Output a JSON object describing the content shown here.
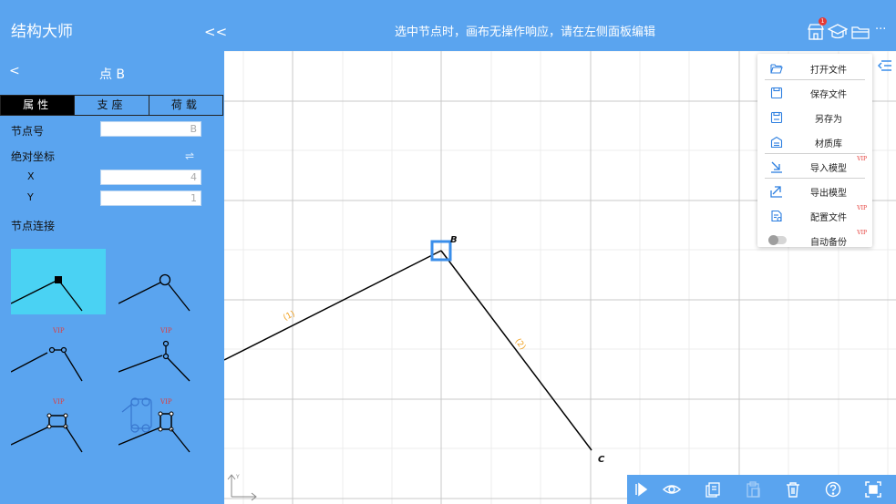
{
  "app": {
    "title": "结构大师",
    "collapse_label": "<<",
    "hint": "选中节点时，画布无操作响应，请在左侧面板编辑",
    "notification_count": "1",
    "more_label": "···"
  },
  "panel": {
    "back_label": "<",
    "title": "点 B",
    "tabs": [
      {
        "label": "属性",
        "active": true
      },
      {
        "label": "支座",
        "active": false
      },
      {
        "label": "荷载",
        "active": false
      }
    ],
    "node_id_label": "节点号",
    "node_id_value": "B",
    "abs_coord_label": "绝对坐标",
    "x_label": "X",
    "x_value": "4",
    "y_label": "Y",
    "y_value": "1",
    "connection_label": "节点连接",
    "connection_types": [
      {
        "icon": "rigid-joint-icon",
        "selected": true,
        "vip": ""
      },
      {
        "icon": "hinge-joint-icon",
        "selected": false,
        "vip": ""
      },
      {
        "icon": "link-joint-icon",
        "selected": false,
        "vip": "VIP"
      },
      {
        "icon": "slider-joint-icon",
        "selected": false,
        "vip": "VIP"
      },
      {
        "icon": "box-link-joint-icon",
        "selected": false,
        "vip": "VIP"
      },
      {
        "icon": "box-slider-joint-icon",
        "selected": false,
        "vip": "VIP"
      }
    ]
  },
  "canvas": {
    "node_b_label": "B",
    "node_c_label": "C",
    "element_1_label": "(1)",
    "element_2_label": "(2)",
    "axis_y_label": "Y"
  },
  "menu": {
    "items": [
      {
        "label": "打开文件",
        "icon": "folder-open-icon",
        "vip": ""
      },
      {
        "label": "保存文件",
        "icon": "save-icon",
        "vip": ""
      },
      {
        "label": "另存为",
        "icon": "save-as-icon",
        "vip": ""
      },
      {
        "label": "材质库",
        "icon": "material-library-icon",
        "vip": ""
      },
      {
        "label": "导入模型",
        "icon": "import-icon",
        "vip": "VIP"
      },
      {
        "label": "导出模型",
        "icon": "export-icon",
        "vip": ""
      },
      {
        "label": "配置文件",
        "icon": "config-file-icon",
        "vip": "VIP"
      },
      {
        "label": "自动备份",
        "icon": "toggle-icon",
        "vip": "VIP"
      }
    ]
  },
  "colors": {
    "primary": "#5aa4ef",
    "selected_connection": "#4ad2f3",
    "vip": "#e53935",
    "element_label": "#f0a020"
  }
}
